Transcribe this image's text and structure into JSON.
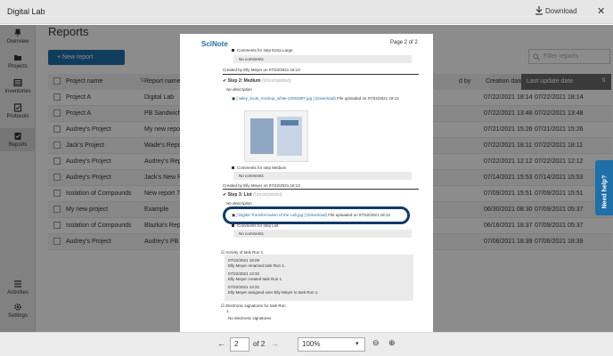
{
  "window": {
    "title": "Digital Lab",
    "download_label": "Download",
    "close_glyph": "✕"
  },
  "sidebar": {
    "items": [
      {
        "label": "Overview",
        "icon": "pin-icon"
      },
      {
        "label": "Projects",
        "icon": "folder-icon"
      },
      {
        "label": "Inventories",
        "icon": "inventory-icon"
      },
      {
        "label": "Protocols",
        "icon": "protocol-icon"
      },
      {
        "label": "Reports",
        "icon": "reports-icon"
      }
    ],
    "bottom": [
      {
        "label": "Activities",
        "icon": "list-icon"
      },
      {
        "label": "Settings",
        "icon": "gear-icon"
      }
    ]
  },
  "main": {
    "title": "Reports",
    "new_report_label": "+ New report",
    "filter_placeholder": "Filter reports",
    "columns": [
      "Project name",
      "Report name",
      "d by",
      "Creation date",
      "Last update date"
    ],
    "rows": [
      [
        "Project A",
        "Digital Lab",
        "07/22/2021 18:14",
        "07/22/2021 18:14"
      ],
      [
        "Project A",
        "PB Sandwich 2",
        "07/22/2021 13:48",
        "07/22/2021 13:48"
      ],
      [
        "Audrey's Project",
        "My new report",
        "07/21/2021 15:26",
        "07/21/2021 15:26"
      ],
      [
        "Jack's Project",
        "Wade's Report",
        "07/22/2021 18:11",
        "07/22/2021 18:11"
      ],
      [
        "Audrey's Project",
        "Audrey's Repo",
        "07/22/2021 12:12",
        "07/22/2021 12:12"
      ],
      [
        "Audrey's Project",
        "Jack's New Re",
        "07/14/2021 15:53",
        "07/14/2021 15:53"
      ],
      [
        "Isolation of Compounds",
        "New report 7",
        "07/09/2021 15:51",
        "07/09/2021 15:51"
      ],
      [
        "My new project",
        "Example",
        "06/30/2021 08:30",
        "07/09/2021 05:37"
      ],
      [
        "Isolation of Compounds",
        "Blazka's Repo",
        "06/16/2021 18:37",
        "07/09/2021 05:37"
      ],
      [
        "Audrey's Project",
        "Audrey's PB S",
        "07/06/2021 18:39",
        "07/06/2021 18:39"
      ]
    ],
    "need_help_label": "Need help?"
  },
  "document": {
    "logo": "SciNote",
    "page_indicator": "Page 2 of 2",
    "lines": {
      "c_xl": "Comments for step Extra Large",
      "no_comments": "No comments",
      "created_by_1": "Created by Elly Meyer on 07/22/2021 18:13",
      "step2_title": "Step 2: Medium",
      "step2_state": "(Uncompleted)",
      "no_description": "No description",
      "step2_file": "[ wiley_book_mockup_white-2200x897.jpg ]",
      "step2_download": "(Download)",
      "step2_uploaded": "File uploaded on 07/22/2021 18:12",
      "c_medium": "Comments for step Medium",
      "created_by_2": "Created by Elly Meyer on 07/22/2021 18:13",
      "step3_title": "Step 3: List",
      "step3_state": "(Uncompleted)",
      "no_desc_partial": "No description",
      "step3_file": "[ Digital Transformation of the Lab.jpg ]",
      "step3_download": "(Download)",
      "step3_uploaded": "File uploaded on 07/22/2021 18:13",
      "c_list": "Comments for step List",
      "activity_title": "Activity of task Run 1",
      "act1_time": "07/22/2021 18:09",
      "act1_text": "Elly Meyer renamed task Run 1.",
      "act2_time": "07/22/2021 13:32",
      "act2_text": "Elly Meyer created task Run 1.",
      "act3_time": "07/22/2021 13:32",
      "act3_text": "Elly Meyer assigned user Elly Meyer to task Run 1.",
      "esig_title": "Electronic signatures for task Run",
      "esig_num": "1.",
      "no_esig": "No electronic signatures"
    }
  },
  "pager": {
    "page": "2",
    "of_label": "of 2",
    "zoom": "100%"
  },
  "colors": {
    "accent": "#1f6fa8",
    "highlight_ring": "#123a6a",
    "overlay": "rgba(0,0,0,0.45)"
  }
}
